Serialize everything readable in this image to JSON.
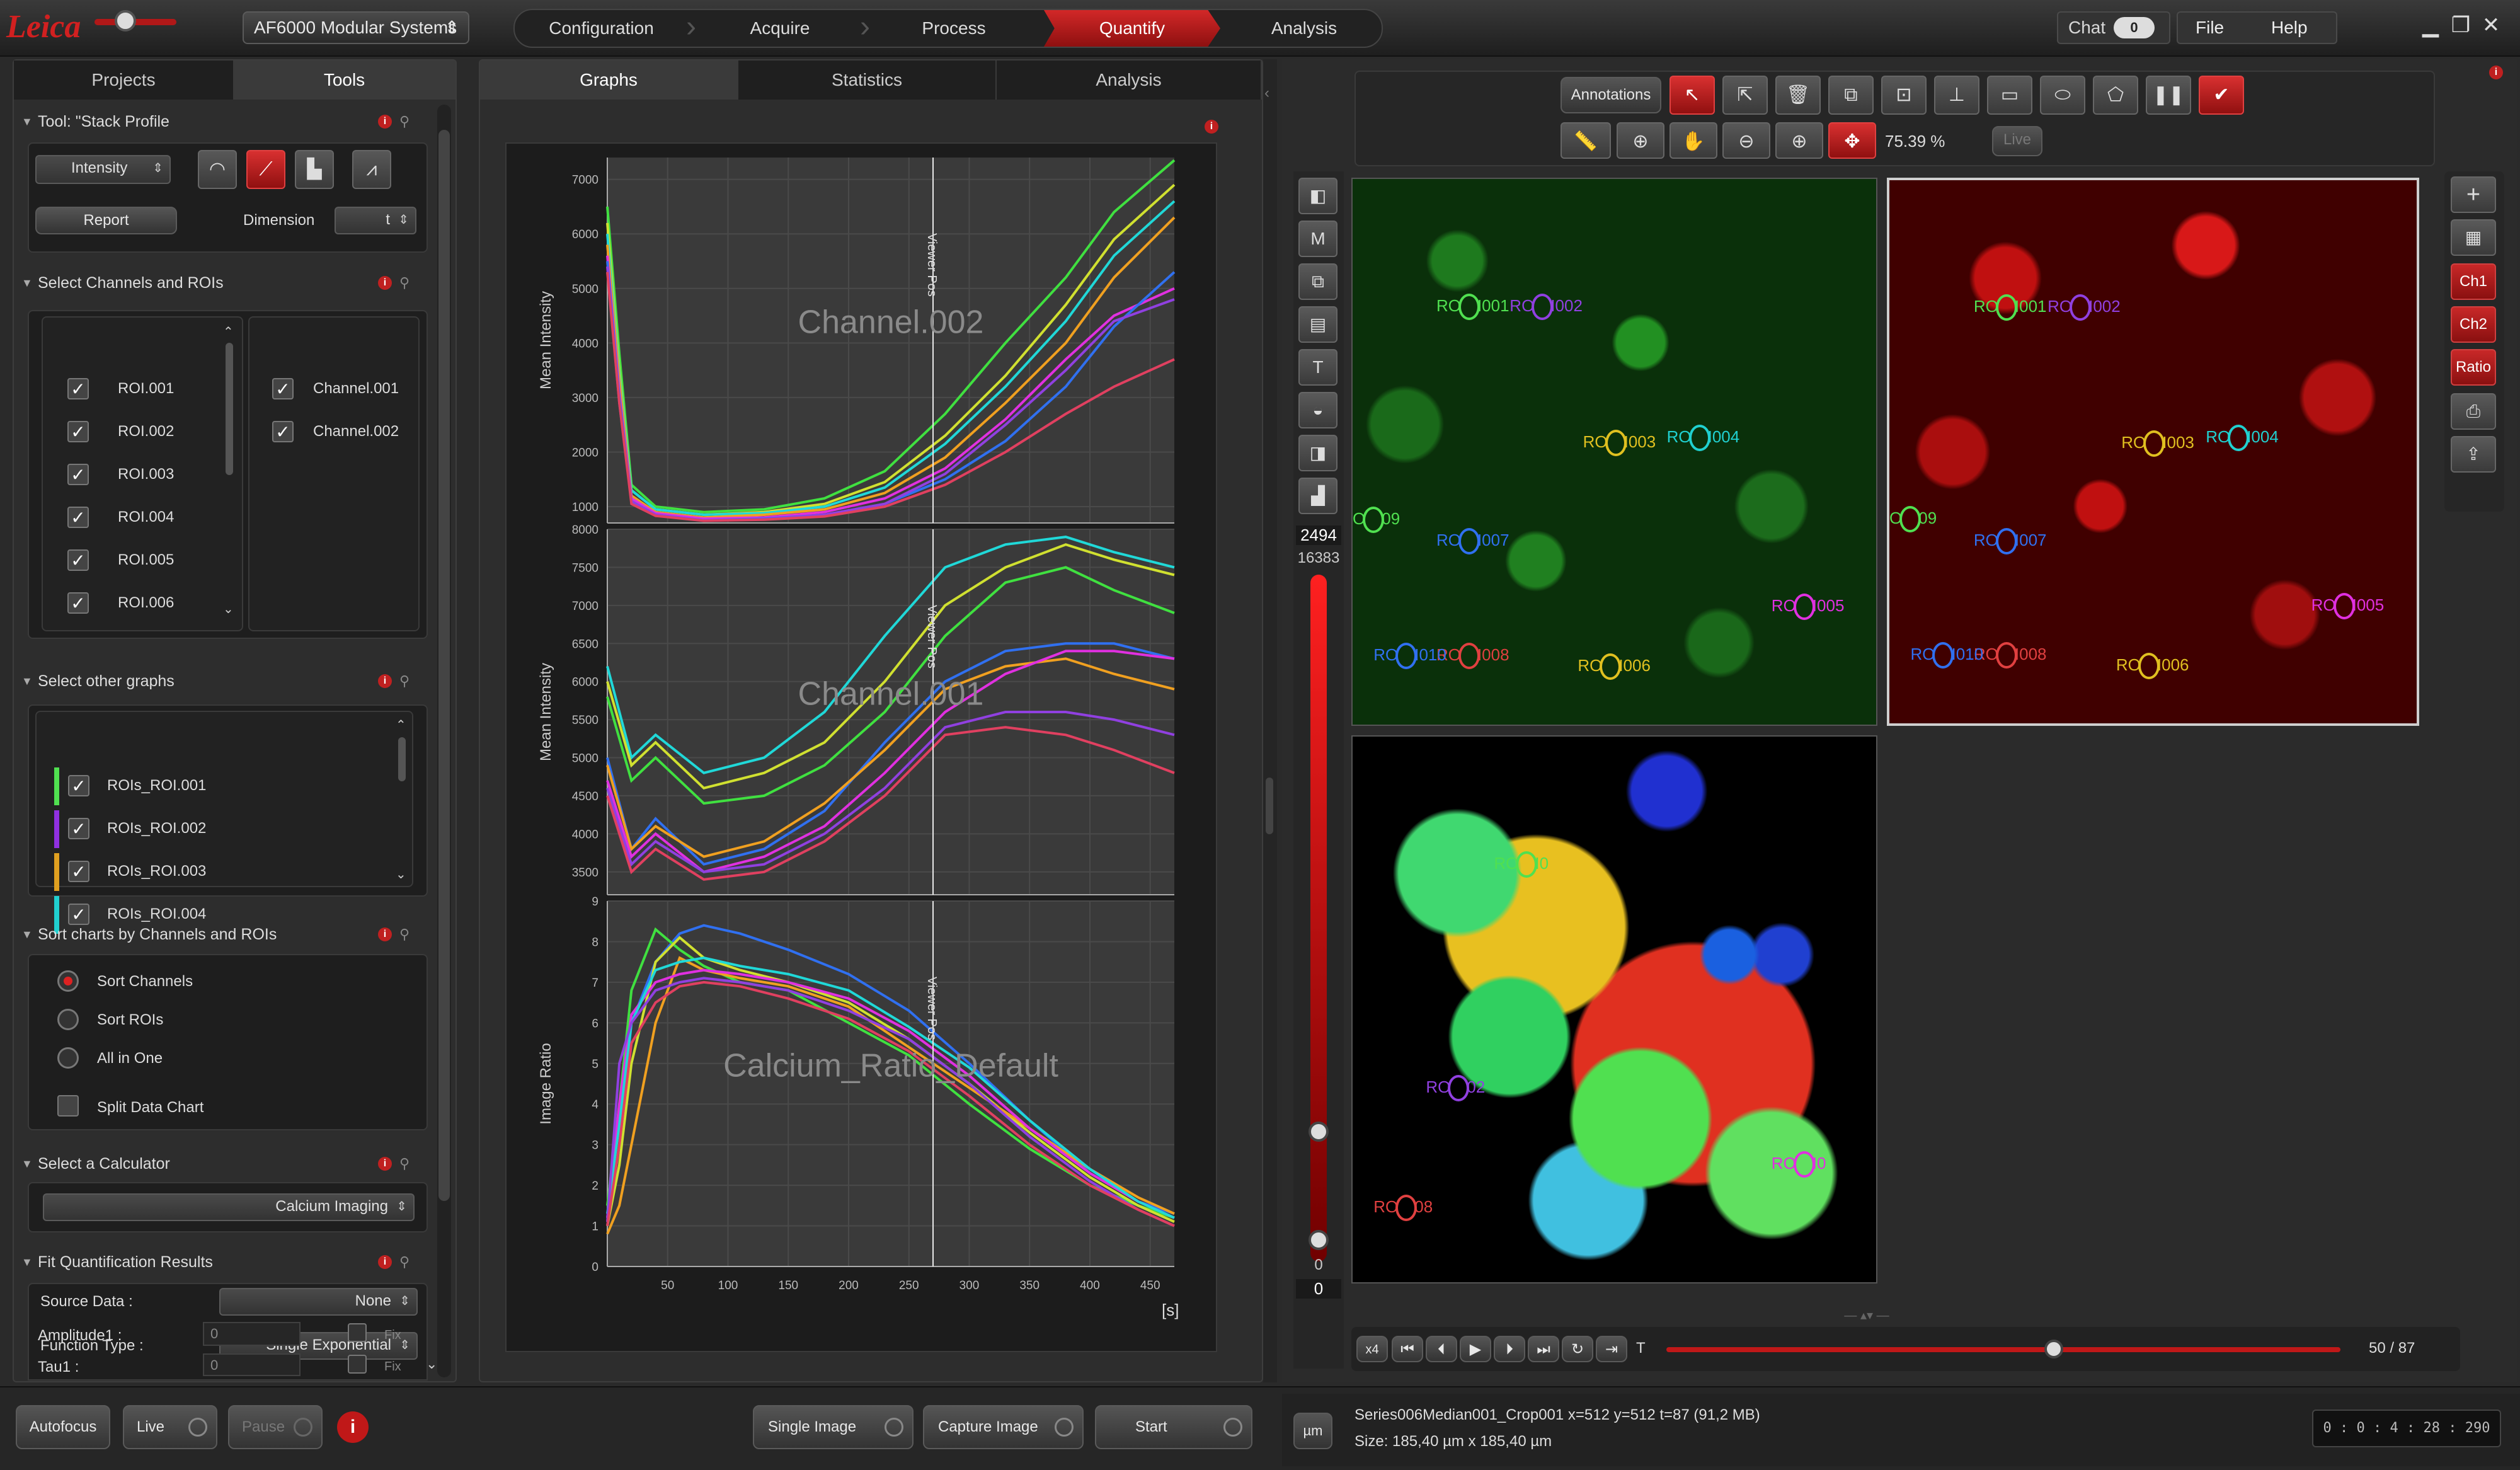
{
  "title_bar": {
    "logo": "Leica",
    "product": "AF6000 Modular Systems",
    "workflow": [
      "Configuration",
      "Acquire",
      "Process",
      "Quantify",
      "Analysis"
    ],
    "active_step": "Quantify",
    "chat_label": "Chat",
    "chat_count": "0",
    "menu": [
      "File",
      "Help"
    ]
  },
  "left_panel": {
    "tabs": [
      "Projects",
      "Tools"
    ],
    "active_tab": "Tools",
    "tool_section": {
      "title": "Tool: \"Stack Profile",
      "mode": "Intensity",
      "report_label": "Report",
      "dimension_label": "Dimension",
      "dimension_value": "t"
    },
    "channels_section": {
      "title": "Select Channels and ROIs",
      "rois": [
        "ROI.001",
        "ROI.002",
        "ROI.003",
        "ROI.004",
        "ROI.005",
        "ROI.006"
      ],
      "channels": [
        "Channel.001",
        "Channel.002"
      ]
    },
    "other_graphs_section": {
      "title": "Select other graphs",
      "items": [
        {
          "label": "ROIs_ROI.001",
          "color": "#50e050"
        },
        {
          "label": "ROIs_ROI.002",
          "color": "#9030e0"
        },
        {
          "label": "ROIs_ROI.003",
          "color": "#e0a020"
        },
        {
          "label": "ROIs_ROI.004",
          "color": "#20d0d0"
        }
      ]
    },
    "sort_section": {
      "title": "Sort charts by Channels and ROIs",
      "options": [
        "Sort Channels",
        "Sort ROIs",
        "All in One"
      ],
      "selected": "Sort Channels",
      "split_label": "Split Data Chart"
    },
    "calculator_section": {
      "title": "Select a Calculator",
      "value": "Calcium Imaging"
    },
    "fit_section": {
      "title": "Fit Quantification Results",
      "source_label": "Source Data :",
      "source_value": "None",
      "function_label": "Function Type :",
      "function_value": "Single Exponential",
      "amp_label": "Amplitude1 :",
      "amp_value": "0",
      "tau_label": "Tau1 :",
      "tau_value": "0",
      "fix_label": "Fix"
    }
  },
  "center_panel": {
    "tabs": [
      "Graphs",
      "Statistics",
      "Analysis"
    ],
    "active_tab": "Graphs",
    "viewer_pos_label": "Viewer Pos",
    "x_unit": "[s]"
  },
  "chart_data": [
    {
      "type": "line",
      "title": "Channel.002",
      "ylabel": "Mean Intensity",
      "ylim": [
        700,
        7400
      ],
      "yticks": [
        1000,
        2000,
        3000,
        4000,
        5000,
        6000,
        7000
      ],
      "xlim": [
        0,
        470
      ],
      "xticks": [
        50,
        100,
        150,
        200,
        250,
        300,
        350,
        400,
        450
      ],
      "series": [
        {
          "color": "#40e040",
          "x": [
            0,
            10,
            20,
            40,
            80,
            130,
            180,
            230,
            280,
            330,
            380,
            420,
            470
          ],
          "y": [
            6500,
            3800,
            1400,
            1000,
            900,
            950,
            1150,
            1650,
            2700,
            4000,
            5200,
            6400,
            7350
          ]
        },
        {
          "color": "#d0e030",
          "x": [
            0,
            10,
            20,
            40,
            80,
            130,
            180,
            230,
            280,
            330,
            380,
            420,
            470
          ],
          "y": [
            6200,
            3500,
            1300,
            950,
            850,
            900,
            1050,
            1450,
            2300,
            3400,
            4700,
            5900,
            6900
          ]
        },
        {
          "color": "#20d8d8",
          "x": [
            0,
            10,
            20,
            40,
            80,
            130,
            180,
            230,
            280,
            330,
            380,
            420,
            470
          ],
          "y": [
            6000,
            3400,
            1300,
            950,
            850,
            880,
            1000,
            1350,
            2150,
            3200,
            4400,
            5600,
            6600
          ]
        },
        {
          "color": "#f0a020",
          "x": [
            0,
            10,
            20,
            40,
            80,
            130,
            180,
            230,
            280,
            330,
            380,
            420,
            470
          ],
          "y": [
            5800,
            3300,
            1200,
            900,
            800,
            850,
            950,
            1250,
            1900,
            2900,
            4000,
            5200,
            6300
          ]
        },
        {
          "color": "#e030e0",
          "x": [
            0,
            10,
            20,
            40,
            80,
            130,
            180,
            230,
            280,
            330,
            380,
            420,
            470
          ],
          "y": [
            5600,
            3100,
            1150,
            880,
            780,
            800,
            900,
            1150,
            1700,
            2600,
            3700,
            4500,
            5000
          ]
        },
        {
          "color": "#3070f0",
          "x": [
            0,
            10,
            20,
            40,
            80,
            130,
            180,
            230,
            280,
            330,
            380,
            420,
            470
          ],
          "y": [
            5500,
            3000,
            1100,
            850,
            750,
            780,
            850,
            1050,
            1500,
            2200,
            3200,
            4300,
            5300
          ]
        },
        {
          "color": "#9040e0",
          "x": [
            0,
            10,
            20,
            40,
            80,
            130,
            180,
            230,
            280,
            330,
            380,
            420,
            470
          ],
          "y": [
            5400,
            2900,
            1100,
            850,
            750,
            770,
            850,
            1050,
            1600,
            2500,
            3500,
            4400,
            4800
          ]
        },
        {
          "color": "#e04060",
          "x": [
            0,
            10,
            20,
            40,
            80,
            130,
            180,
            230,
            280,
            330,
            380,
            420,
            470
          ],
          "y": [
            5300,
            2900,
            1050,
            830,
            740,
            760,
            820,
            1000,
            1400,
            2000,
            2700,
            3200,
            3700
          ]
        }
      ]
    },
    {
      "type": "line",
      "title": "Channel.001",
      "ylabel": "Mean Intensity",
      "ylim": [
        3200,
        8000
      ],
      "yticks": [
        3500,
        4000,
        4500,
        5000,
        5500,
        6000,
        6500,
        7000,
        7500,
        8000
      ],
      "xlim": [
        0,
        470
      ],
      "xticks": [
        50,
        100,
        150,
        200,
        250,
        300,
        350,
        400,
        450
      ],
      "series": [
        {
          "color": "#20d8d8",
          "x": [
            0,
            20,
            40,
            80,
            130,
            180,
            230,
            280,
            330,
            380,
            420,
            470
          ],
          "y": [
            6200,
            5000,
            5300,
            4800,
            5000,
            5600,
            6600,
            7500,
            7800,
            7900,
            7700,
            7500
          ]
        },
        {
          "color": "#d0e030",
          "x": [
            0,
            20,
            40,
            80,
            130,
            180,
            230,
            280,
            330,
            380,
            420,
            470
          ],
          "y": [
            6000,
            4900,
            5200,
            4600,
            4800,
            5200,
            6000,
            7000,
            7500,
            7800,
            7600,
            7400
          ]
        },
        {
          "color": "#40e040",
          "x": [
            0,
            20,
            40,
            80,
            130,
            180,
            230,
            280,
            330,
            380,
            420,
            470
          ],
          "y": [
            5800,
            4700,
            5000,
            4400,
            4500,
            4900,
            5600,
            6600,
            7300,
            7500,
            7200,
            6900
          ]
        },
        {
          "color": "#3070f0",
          "x": [
            0,
            20,
            40,
            80,
            130,
            180,
            230,
            280,
            330,
            380,
            420,
            470
          ],
          "y": [
            5000,
            3800,
            4200,
            3600,
            3800,
            4300,
            5200,
            6000,
            6400,
            6500,
            6500,
            6300
          ]
        },
        {
          "color": "#f0a020",
          "x": [
            0,
            20,
            40,
            80,
            130,
            180,
            230,
            280,
            330,
            380,
            420,
            470
          ],
          "y": [
            4900,
            3800,
            4100,
            3700,
            3900,
            4400,
            5100,
            5900,
            6200,
            6300,
            6100,
            5900
          ]
        },
        {
          "color": "#e030e0",
          "x": [
            0,
            20,
            40,
            80,
            130,
            180,
            230,
            280,
            330,
            380,
            420,
            470
          ],
          "y": [
            4700,
            3700,
            4000,
            3500,
            3700,
            4100,
            4800,
            5600,
            6100,
            6400,
            6400,
            6300
          ]
        },
        {
          "color": "#9040e0",
          "x": [
            0,
            20,
            40,
            80,
            130,
            180,
            230,
            280,
            330,
            380,
            420,
            470
          ],
          "y": [
            4600,
            3600,
            3900,
            3500,
            3600,
            4000,
            4600,
            5400,
            5600,
            5600,
            5500,
            5300
          ]
        },
        {
          "color": "#e04060",
          "x": [
            0,
            20,
            40,
            80,
            130,
            180,
            230,
            280,
            330,
            380,
            420,
            470
          ],
          "y": [
            4500,
            3500,
            3800,
            3400,
            3500,
            3900,
            4500,
            5300,
            5400,
            5300,
            5100,
            4800
          ]
        }
      ]
    },
    {
      "type": "line",
      "title": "Calcium_Ratio_Default",
      "ylabel": "Image Ratio",
      "ylim": [
        0,
        9
      ],
      "yticks": [
        0,
        1,
        2,
        3,
        4,
        5,
        6,
        7,
        8,
        9
      ],
      "xlim": [
        0,
        470
      ],
      "xticks": [
        50,
        100,
        150,
        200,
        250,
        300,
        350,
        400,
        450
      ],
      "series": [
        {
          "color": "#3070f0",
          "x": [
            0,
            10,
            20,
            40,
            60,
            80,
            110,
            150,
            200,
            250,
            300,
            350,
            400,
            440,
            470
          ],
          "y": [
            1,
            3,
            6,
            7.5,
            8.2,
            8.4,
            8.2,
            7.8,
            7.2,
            6.3,
            5.0,
            3.6,
            2.3,
            1.6,
            1.3
          ]
        },
        {
          "color": "#40e040",
          "x": [
            0,
            10,
            20,
            40,
            60,
            80,
            110,
            150,
            200,
            250,
            300,
            350,
            400,
            440,
            470
          ],
          "y": [
            1.5,
            4,
            6.8,
            8.3,
            7.8,
            7.4,
            7.0,
            6.8,
            6.0,
            5.2,
            4.0,
            2.9,
            2.0,
            1.5,
            1.2
          ]
        },
        {
          "color": "#d0e030",
          "x": [
            0,
            10,
            20,
            40,
            60,
            80,
            110,
            150,
            200,
            250,
            300,
            350,
            400,
            440,
            470
          ],
          "y": [
            1,
            2.5,
            5,
            7.5,
            8.1,
            7.6,
            7.3,
            7.0,
            6.5,
            5.6,
            4.5,
            3.3,
            2.2,
            1.5,
            1.1
          ]
        },
        {
          "color": "#f0a020",
          "x": [
            0,
            10,
            20,
            40,
            60,
            80,
            110,
            150,
            200,
            250,
            300,
            350,
            400,
            440,
            470
          ],
          "y": [
            0.8,
            1.5,
            3,
            6,
            7.6,
            7.3,
            7.1,
            6.9,
            6.4,
            5.4,
            4.4,
            3.4,
            2.4,
            1.7,
            1.3
          ]
        },
        {
          "color": "#e030e0",
          "x": [
            0,
            10,
            20,
            40,
            60,
            80,
            110,
            150,
            200,
            250,
            300,
            350,
            400,
            440,
            470
          ],
          "y": [
            1.2,
            4,
            6.2,
            7.0,
            7.2,
            7.3,
            7.2,
            7.0,
            6.6,
            5.8,
            4.7,
            3.4,
            2.3,
            1.6,
            1.2
          ]
        },
        {
          "color": "#20d8d8",
          "x": [
            0,
            10,
            20,
            40,
            60,
            80,
            110,
            150,
            200,
            250,
            300,
            350,
            400,
            440,
            470
          ],
          "y": [
            1.3,
            3.5,
            6,
            7.3,
            7.5,
            7.6,
            7.4,
            7.2,
            6.8,
            5.9,
            4.9,
            3.6,
            2.4,
            1.6,
            1.2
          ]
        },
        {
          "color": "#9040e0",
          "x": [
            0,
            10,
            20,
            40,
            60,
            80,
            110,
            150,
            200,
            250,
            300,
            350,
            400,
            440,
            470
          ],
          "y": [
            1.1,
            5,
            6.0,
            6.8,
            7.0,
            7.1,
            7.0,
            6.8,
            6.3,
            5.6,
            4.5,
            3.2,
            2.1,
            1.4,
            1.0
          ]
        },
        {
          "color": "#e04060",
          "x": [
            0,
            10,
            20,
            40,
            60,
            80,
            110,
            150,
            200,
            250,
            300,
            350,
            400,
            440,
            470
          ],
          "y": [
            1.0,
            3,
            5.5,
            6.5,
            6.9,
            7.0,
            6.9,
            6.6,
            6.1,
            5.3,
            4.2,
            3.0,
            2.0,
            1.4,
            1.0
          ]
        }
      ]
    }
  ],
  "viewer_pos_x": 270,
  "right_panel": {
    "annotations_label": "Annotations",
    "zoom": "75.39 %",
    "live_label": "Live",
    "intensity_max": "2494",
    "intensity_range": "16383",
    "intensity_min_top": "0",
    "intensity_min_bottom": "0",
    "image_side_buttons": [
      "Ch1",
      "Ch2",
      "Ratio"
    ],
    "speed_label": "x4",
    "t_label": "T",
    "frame_counter": "50 / 87",
    "playback_fraction": 0.575
  },
  "rois_green": [
    {
      "label": "ROI.001",
      "color": "#50e050"
    },
    {
      "label": "ROI.002",
      "color": "#9040e0"
    },
    {
      "label": "ROI.003",
      "color": "#e0c020"
    },
    {
      "label": "ROI.004",
      "color": "#20d0d0"
    },
    {
      "label": "ROI.005",
      "color": "#e030e0"
    },
    {
      "label": "ROI.006",
      "color": "#e0c020"
    },
    {
      "label": "ROI.007",
      "color": "#3070f0"
    },
    {
      "label": "ROI.008",
      "color": "#e04040"
    },
    {
      "label": "ROI.009",
      "color": "#50e050"
    },
    {
      "label": "ROI.010",
      "color": "#3070f0"
    }
  ],
  "roi_texts": {
    "green": [
      "RO",
      "I001",
      "RO",
      "I002",
      "RO",
      "I003",
      "RO",
      "I004",
      "RO",
      "I005",
      "RO",
      "I006",
      "RO",
      "I007",
      "RO",
      "I008",
      "O",
      "09",
      "RO",
      "I010"
    ],
    "ratio": [
      "RO",
      "I0",
      "RO",
      "02",
      "RO",
      "I0",
      "RO",
      "08"
    ]
  },
  "status": {
    "autofocus": "Autofocus",
    "live": "Live",
    "pause": "Pause",
    "single_image": "Single Image",
    "capture_image": "Capture Image",
    "start": "Start",
    "unit_btn": "µm",
    "image_info": "Series006Median001_Crop001 x=512 y=512 t=87  (91,2 MB)",
    "size_info": "Size: 185,40 µm x 185,40 µm",
    "timer": "0 : 0 : 4 : 28 : 290"
  }
}
